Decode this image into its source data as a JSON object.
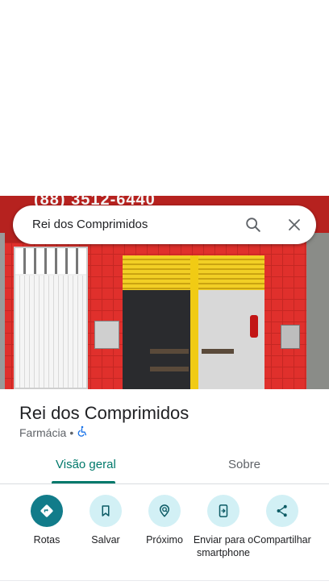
{
  "search": {
    "query": "Rei dos Comprimidos"
  },
  "photo": {
    "sign_text": "(88) 3512-6440"
  },
  "place": {
    "title": "Rei dos Comprimidos",
    "category": "Farmácia",
    "separator": "•",
    "accessibility_icon": "wheelchair-icon"
  },
  "tabs": [
    {
      "label": "Visão geral",
      "active": true
    },
    {
      "label": "Sobre",
      "active": false
    }
  ],
  "actions": [
    {
      "label": "Rotas",
      "icon": "directions-icon"
    },
    {
      "label": "Salvar",
      "icon": "bookmark-icon"
    },
    {
      "label": "Próximo",
      "icon": "nearby-icon"
    },
    {
      "label": "Enviar para o smartphone",
      "icon": "send-to-phone-icon"
    },
    {
      "label": "Compartilhar",
      "icon": "share-icon"
    }
  ],
  "colors": {
    "accent": "#00796b",
    "primary_action": "#127c8a",
    "action_bg": "#d2f0f5",
    "accessibility_blue": "#1a73e8"
  }
}
